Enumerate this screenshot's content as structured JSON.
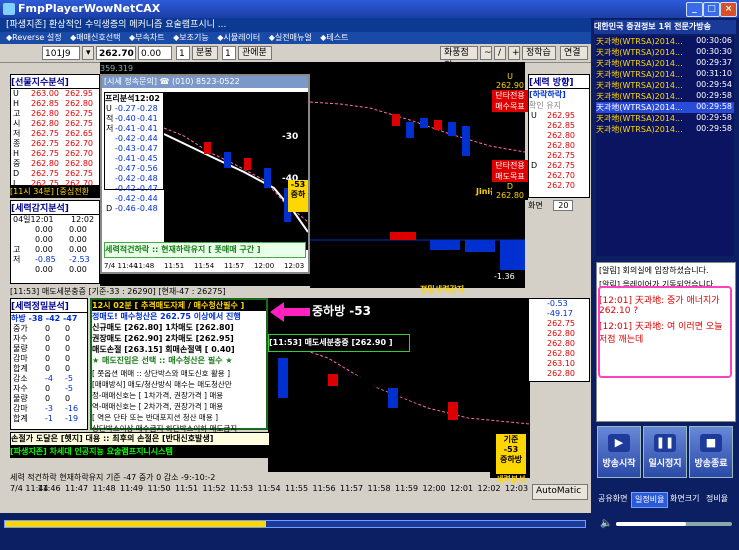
{
  "window": {
    "title": "FmpPlayerWowNetCAX",
    "min_label": "_",
    "max_label": "□",
    "close_label": "×"
  },
  "app": {
    "title": "[파생지존] 환상적인 수익생증의 메커니즘 요술램프시니 ...",
    "menu": [
      "◆Reverse 설정",
      "◆매매신호선택",
      "◆부속차트",
      "◆보조기능",
      "◆시뮬레이터",
      "◆실전매뉴얼",
      "◆테스트"
    ],
    "toolbar": {
      "code": "101J9",
      "price": "262.70",
      "change": "0.00",
      "interval": "1",
      "unit1": "분봉",
      "unit2": "1",
      "unit3": "관에분",
      "btn_env": "화풍점정",
      "btn_order": "정학습",
      "btn_link": "연결"
    },
    "ticker_strip": "359.319"
  },
  "left_panel1": {
    "title": "[선물지수분석]",
    "rows": [
      {
        "k": "U",
        "a": "263.00",
        "b": "262.95"
      },
      {
        "k": "H",
        "a": "262.85",
        "b": "262.80"
      },
      {
        "k": "고",
        "a": "262.80",
        "b": "262.75"
      },
      {
        "k": "시",
        "a": "262.80",
        "b": "262.75"
      },
      {
        "k": "저",
        "a": "262.75",
        "b": "262.65"
      },
      {
        "k": "종",
        "a": "262.75",
        "b": "262.70"
      },
      {
        "k": "H",
        "a": "262.75",
        "b": "262.70"
      },
      {
        "k": "중",
        "a": "262.80",
        "b": "262.80"
      },
      {
        "k": "D",
        "a": "262.75",
        "b": "262.75"
      },
      {
        "k": "L",
        "a": "262.75",
        "b": "262.70"
      },
      {
        "k": "",
        "a": "0.23",
        "b": "0.24"
      }
    ],
    "side_labels": [
      "저",
      "항",
      "지",
      "지"
    ],
    "footer": "[11시 34분] [중심전환",
    "footer_label": "매매"
  },
  "left_panel2": {
    "title": "[세력감지분석]",
    "time": "04일12:01",
    "time2": "12:02",
    "rows": [
      {
        "k": "",
        "a": "0.00",
        "b": "0.00"
      },
      {
        "k": "",
        "a": "0.00",
        "b": "0.00"
      },
      {
        "k": "고",
        "a": "0.00",
        "b": "0.00"
      },
      {
        "k": "저",
        "a": "-0.85",
        "b": "-2.53"
      },
      {
        "k": "",
        "a": "0.00",
        "b": "0.00"
      }
    ]
  },
  "popup": {
    "title": "[시세 정속문의] ☎ (010) 8523-0522",
    "sub": "프리분석12:02",
    "rows": [
      {
        "k": "U",
        "a": "-0.27",
        "b": "-0.28"
      },
      {
        "k": "적",
        "a": "-0.40",
        "b": "-0.41"
      },
      {
        "k": "저",
        "a": "-0.41",
        "b": "-0.41"
      },
      {
        "k": "",
        "a": "-0.42",
        "b": "-0.44"
      },
      {
        "k": "",
        "a": "-0.43",
        "b": "-0.47"
      },
      {
        "k": "",
        "a": "-0.41",
        "b": "-0.45"
      },
      {
        "k": "",
        "a": "-0.47",
        "b": "-0.56"
      },
      {
        "k": "",
        "a": "-0.42",
        "b": "-0.48"
      },
      {
        "k": "",
        "a": "-0.42",
        "b": "-0.47"
      },
      {
        "k": "",
        "a": "-0.42",
        "b": "-0.44"
      },
      {
        "k": "D",
        "a": "-0.46",
        "b": "-0.48"
      }
    ],
    "levels": [
      "-30",
      "-40"
    ],
    "badge": "-53",
    "badge2": "중하",
    "status": "세력적건하락 :: 현재하락유지 [ 폿매매 구간 ]",
    "times": [
      "7/4 11:44",
      "11:48",
      "11:51",
      "11:54",
      "11:57",
      "12:00",
      "12:03"
    ]
  },
  "right_top": {
    "u": "U 262.90",
    "b1": "단타전용",
    "b2": "매수목표",
    "b3": "단타전용",
    "b4": "매도목표",
    "d": "D 262.80",
    "label": "Jini옵션"
  },
  "right_panel": {
    "title": "[세력 방향]",
    "sub": "[하락하락]",
    "sub2": "확인 유지",
    "side": [
      "매",
      "수",
      "세",
      "력",
      "방",
      "향"
    ],
    "rows": [
      {
        "k": "U",
        "v": "262.95"
      },
      {
        "k": "",
        "v": "262.85"
      },
      {
        "k": "",
        "v": "262.80"
      },
      {
        "k": "",
        "v": "262.80"
      },
      {
        "k": "",
        "v": "262.75"
      },
      {
        "k": "D",
        "v": "262.75"
      },
      {
        "k": "",
        "v": "262.70"
      },
      {
        "k": "",
        "v": "262.70"
      }
    ],
    "page_label": "화면",
    "page_value": "20"
  },
  "mid_chart": {
    "value1": "-1.36",
    "label": "정밀세력감지",
    "header": "[11:53] 매도세분충증 [기준-33 : 26290] [현재-47 : 26275]"
  },
  "bottom_left": {
    "title": "[세력정밀분석]",
    "header": "하방 -38  -42  -47",
    "rows": [
      {
        "k": "중가",
        "a": "0",
        "b": "0"
      },
      {
        "k": "자수",
        "a": "0",
        "b": "0"
      },
      {
        "k": "물량",
        "a": "0",
        "b": "0"
      },
      {
        "k": "감마",
        "a": "0",
        "b": "0"
      },
      {
        "k": "합계",
        "a": "0",
        "b": "0"
      },
      {
        "k": "감소",
        "a": "-4",
        "b": "-5"
      },
      {
        "k": "자수",
        "a": "0",
        "b": "-5"
      },
      {
        "k": "물량",
        "a": "0",
        "b": "0"
      },
      {
        "k": "감마",
        "a": "-3",
        "b": "-16"
      },
      {
        "k": "합계",
        "a": "-1",
        "b": "-19"
      }
    ]
  },
  "signal_box": {
    "head": "12시 02분 [ 추격매도자제 / 매수청산필수 ]",
    "lines": [
      "정매도! 매수청산은 262.75 이상에서 진행",
      "신규매도 [262.80]    1차매도 [262.80]",
      "권장매도 [262.90]    2차매도 [262.95]",
      "매도손절 [263.15]    회매손절액 [ 0.40]",
      "★ 매도진입은 선택  ::  매수청산은 필수 ★"
    ],
    "strategy": [
      "[ 쫏옵션 매매 :: 상단박스와 매도신호 활용 ]",
      "[매매방식] 매도/청산방식 매수는 매도청산만",
      "정-매매신호는 [ 1차가격, 권장가격 ] 매용",
      "역-매매신호는 [ 2차가격, 권장가격 ] 매용",
      "[ 역은 단타 또는 반대포지션 청산 매용 ]",
      "상단박스이상 매수금지  하단박스이하 매도금지",
      "수익이 발생하면 안테나지 챙기는데 집중하세요"
    ],
    "loss": "손절가 도달은 [헷지] 대용 :: 최후의 손절은 [반대신호발생]",
    "footer": "[파생지존] 차세대 인공지능 요술램프지니시스템"
  },
  "annotation": {
    "arrow_text": "중하방 -53"
  },
  "buy_box": {
    "text": "[11:53] 매도세분충증 [262.90 ]"
  },
  "bottom_right": {
    "rows": [
      {
        "k": "",
        "v": "-0.53"
      },
      {
        "k": "",
        "v": "-49.17"
      },
      {
        "k": "",
        "v": "262.75"
      },
      {
        "k": "",
        "v": "262.80"
      },
      {
        "k": "",
        "v": "262.80"
      },
      {
        "k": "",
        "v": "262.80"
      },
      {
        "k": "",
        "v": "263.10"
      },
      {
        "k": "",
        "v": "262.80"
      }
    ],
    "badge_t": "기준",
    "badge_v": "-53",
    "badge_b": "중하방",
    "label": "세력분석"
  },
  "status_line": "세력 적건하락 현재하락유지  기준 -47  중가 0   감소 -9:-10:-2",
  "timeline": [
    "7/4 11:44",
    "11:46",
    "11:47",
    "11:48",
    "11:49",
    "11:50",
    "11:51",
    "11:52",
    "11:53",
    "11:54",
    "11:55",
    "11:56",
    "11:57",
    "11:58",
    "11:59",
    "12:00",
    "12:01",
    "12:02",
    "12:03"
  ],
  "automatic": "AutoMatic",
  "sidebar": {
    "header": "대한민국 증권정보 1위 전문가방송",
    "items": [
      {
        "name": "天과地(WTRSA)2014...",
        "time": "00:30:06"
      },
      {
        "name": "天과地(WTRSA)2014...",
        "time": "00:30:30"
      },
      {
        "name": "天과地(WTRSA)2014...",
        "time": "00:29:37"
      },
      {
        "name": "天과地(WTRSA)2014...",
        "time": "00:31:10"
      },
      {
        "name": "天과地(WTRSA)2014...",
        "time": "00:29:54"
      },
      {
        "name": "天과地(WTRSA)2014...",
        "time": "00:29:58"
      },
      {
        "name": "天과地(WTRSA)2014...",
        "time": "00:29:58"
      },
      {
        "name": "天과地(WTRSA)2014...",
        "time": "00:29:58"
      },
      {
        "name": "天과地(WTRSA)2014...",
        "time": "00:29:58"
      }
    ],
    "chat": [
      "[알림] 회의실에 입장하셨습니다.",
      "[알림] 올레이어가 기동되었습니다.",
      "[12:01] 天과地: 중가 애너지가 262.10 ?",
      "[12:01] 天과地: 여 이러면 오늘 저점 깨는데"
    ],
    "buttons": [
      "방송시작",
      "일시정지",
      "방송종료"
    ],
    "tabs": [
      "공유화면",
      "일정비율",
      "화면크기",
      "정비율"
    ]
  },
  "colors": {
    "accent": "#0c3a92",
    "sidebar": "#0c1f63",
    "chat_highlight": "#ff40c0",
    "arrow": "#ff20c0"
  }
}
